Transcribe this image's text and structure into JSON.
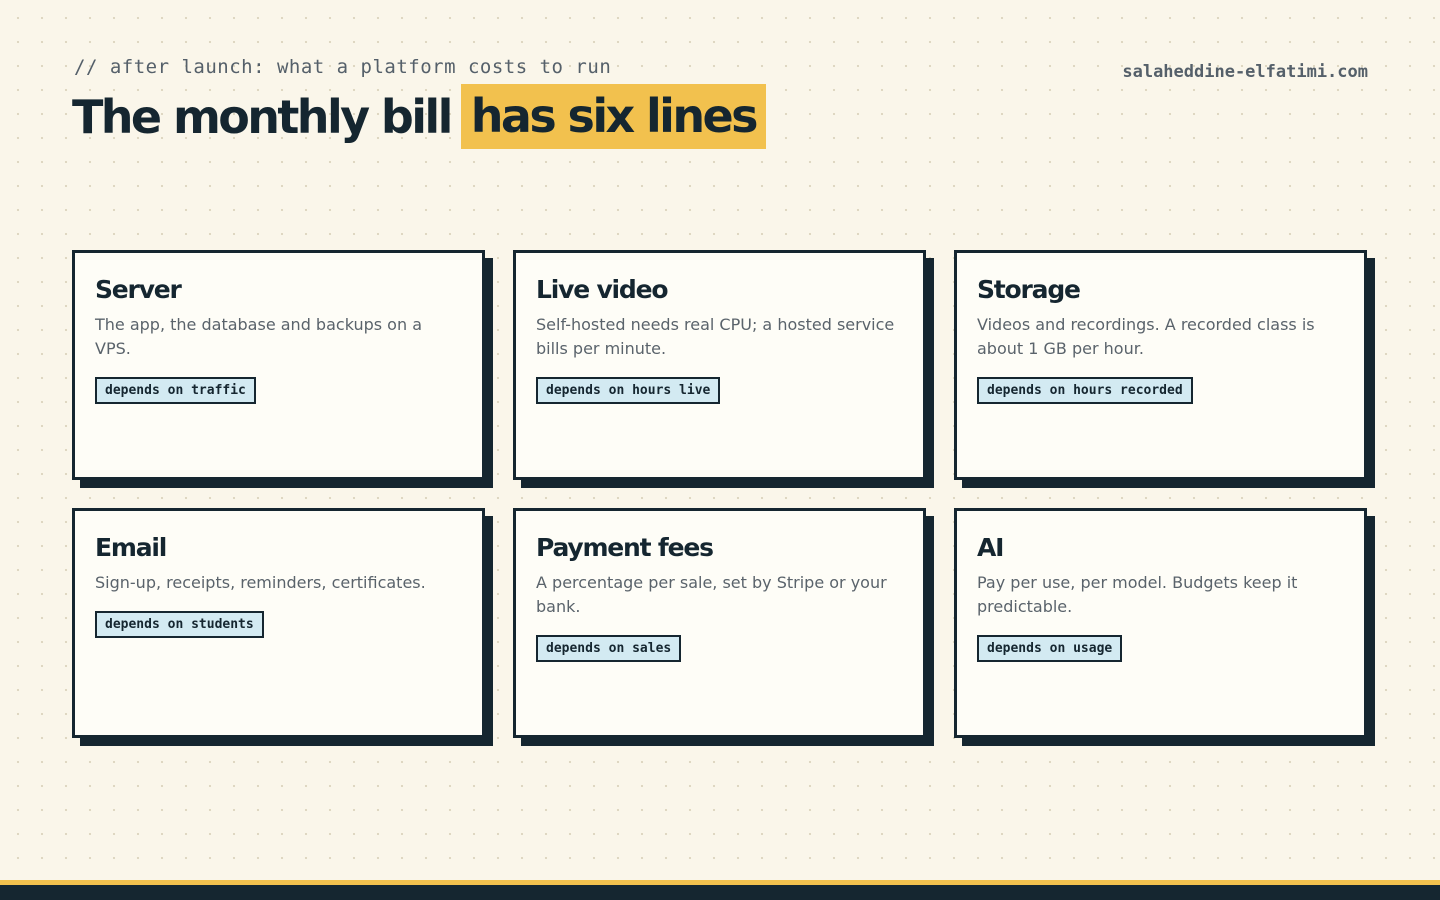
{
  "header": {
    "eyebrow": "// after launch: what a platform costs to run",
    "site": "salaheddine-elfatimi.com",
    "title_plain": "The monthly bill",
    "title_highlight": "has six lines"
  },
  "cards": [
    {
      "title": "Server",
      "desc": "The app, the database and backups on a VPS.",
      "tag": "depends on traffic"
    },
    {
      "title": "Live video",
      "desc": "Self-hosted needs real CPU; a hosted service bills per minute.",
      "tag": "depends on hours live"
    },
    {
      "title": "Storage",
      "desc": "Videos and recordings. A recorded class is about 1 GB per hour.",
      "tag": "depends on hours recorded"
    },
    {
      "title": "Email",
      "desc": "Sign-up, receipts, reminders, certificates.",
      "tag": "depends on students"
    },
    {
      "title": "Payment fees",
      "desc": "A percentage per sale, set by Stripe or your bank.",
      "tag": "depends on sales"
    },
    {
      "title": "AI",
      "desc": "Pay per use, per model. Budgets keep it predictable.",
      "tag": "depends on usage"
    }
  ],
  "colors": {
    "background": "#faf6ea",
    "ink": "#152630",
    "highlight": "#f2c14e",
    "tag_fill": "#d3eaf2",
    "muted_text": "#5a636b"
  }
}
